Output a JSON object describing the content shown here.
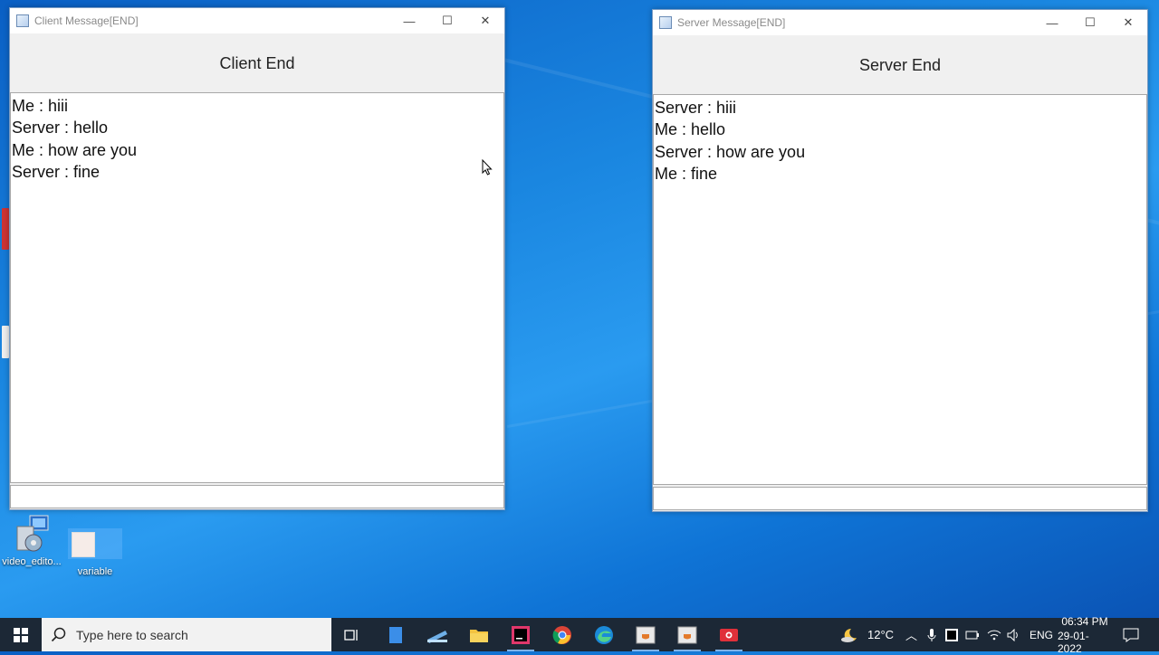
{
  "client_window": {
    "title": "Client Message[END]",
    "header": "Client End",
    "messages": [
      "Me : hiii",
      "Server : hello",
      "Me : how are you",
      "Server : fine"
    ],
    "input_value": ""
  },
  "server_window": {
    "title": "Server Message[END]",
    "header": "Server End",
    "messages": [
      "Server : hiii",
      "Me : hello",
      "Server : how are you",
      "Me : fine"
    ],
    "input_value": ""
  },
  "window_controls": {
    "minimize": "—",
    "maximize": "☐",
    "close": "✕"
  },
  "desktop_icons": [
    {
      "label": "video_edito..."
    },
    {
      "label": "variable"
    }
  ],
  "taskbar": {
    "search_placeholder": "Type here to search",
    "weather": "12°C",
    "language": "ENG",
    "time": "06:34 PM",
    "date": "29-01-2022"
  }
}
